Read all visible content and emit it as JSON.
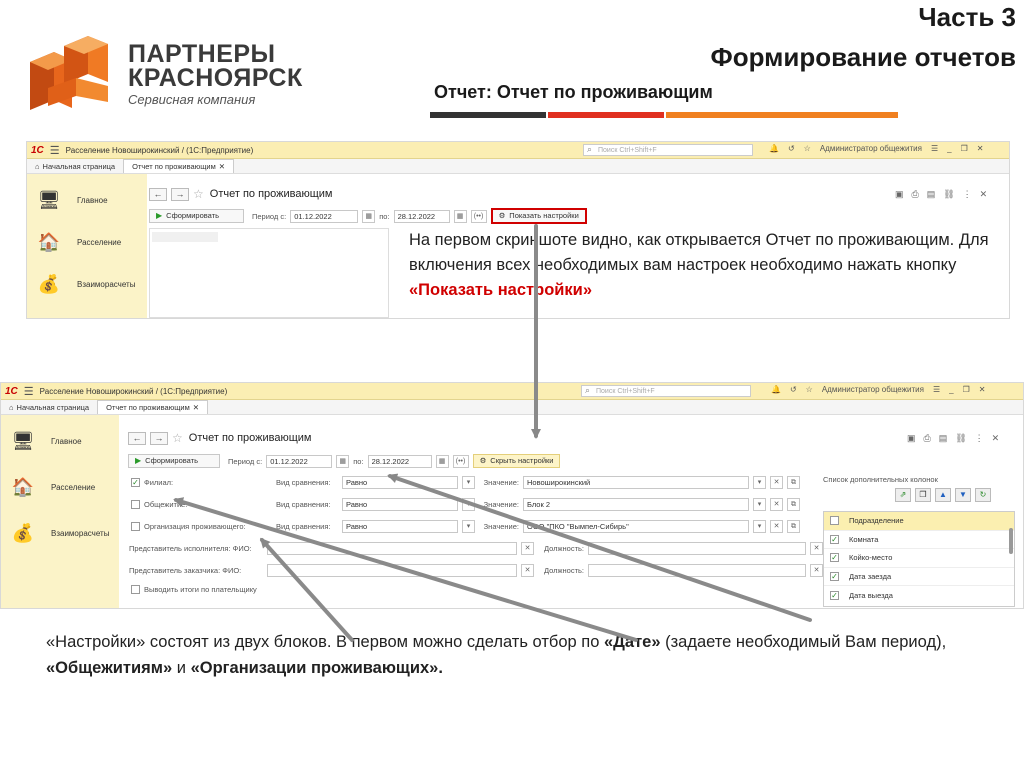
{
  "header": {
    "logo_line1": "ПАРТНЕРЫ",
    "logo_line2": "КРАСНОЯРСК",
    "logo_line3": "Сервисная компания",
    "part": "Часть 3",
    "title": "Формирование отчетов",
    "subtitle": "Отчет: Отчет по проживающим"
  },
  "colors": {
    "bar_dark": "#333333",
    "bar_red": "#e03020",
    "bar_orange": "#f08020",
    "highlight_red": "#d00000",
    "sidebar": "#fbf3c8",
    "titlebar": "#fbeeb3"
  },
  "app": {
    "brand": "1С",
    "title": "Расселение Новоширокинский /  (1С:Предприятие)",
    "search_placeholder": "Поиск Ctrl+Shift+F",
    "user": "Администратор общежития",
    "tabs": [
      "Начальная страница",
      "Отчет по проживающим"
    ],
    "sidebar": [
      "Главное",
      "Расселение",
      "Взаиморасчеты"
    ],
    "form_title": "Отчет по проживающим",
    "generate": "Сформировать",
    "period_label": "Период с:",
    "period_from": "01.12.2022",
    "period_to_label": "по:",
    "period_to": "28.12.2022",
    "show_settings": "Показать настройки",
    "hide_settings": "Скрыть настройки"
  },
  "filters": [
    {
      "checked": true,
      "label": "Филиал:",
      "cmp_label": "Вид сравнения:",
      "cmp": "Равно",
      "val_label": "Значение:",
      "value": "Новоширокинский"
    },
    {
      "checked": false,
      "label": "Общежитие:",
      "cmp_label": "Вид сравнения:",
      "cmp": "Равно",
      "val_label": "Значение:",
      "value": "Блок 2"
    },
    {
      "checked": false,
      "label": "Организация проживающего:",
      "cmp_label": "Вид сравнения:",
      "cmp": "Равно",
      "val_label": "Значение:",
      "value": "ООО \"ПКО \"Вымпел-Сибирь\""
    }
  ],
  "reps": [
    {
      "label": "Представитель исполнителя: ФИО:",
      "pos_label": "Должность:"
    },
    {
      "label": "Представитель заказчика: ФИО:",
      "pos_label": "Должность:"
    }
  ],
  "totals_label": "Выводить итоги по плательщику",
  "columns_panel": {
    "title": "Список дополнительных колонок",
    "items": [
      {
        "label": "Подразделение",
        "checked": false
      },
      {
        "label": "Комната",
        "checked": true
      },
      {
        "label": "Койко-место",
        "checked": true
      },
      {
        "label": "Дата заезда",
        "checked": true
      },
      {
        "label": "Дата выезда",
        "checked": true
      }
    ]
  },
  "note1": {
    "text": "На первом скриншоте видно, как открывается Отчет по проживающим. Для включения всех необходимых вам настроек необходимо нажать кнопку ",
    "highlight": "«Показать настройки»"
  },
  "note2": {
    "t1": "«Настройки» состоят из двух блоков. В первом можно сделать отбор по ",
    "b1": "«Дате»",
    "t2": " (задаете необходимый Вам период), ",
    "b2": "«Общежитиям»",
    "t3": " и ",
    "b3": "«Организации проживающих»."
  }
}
